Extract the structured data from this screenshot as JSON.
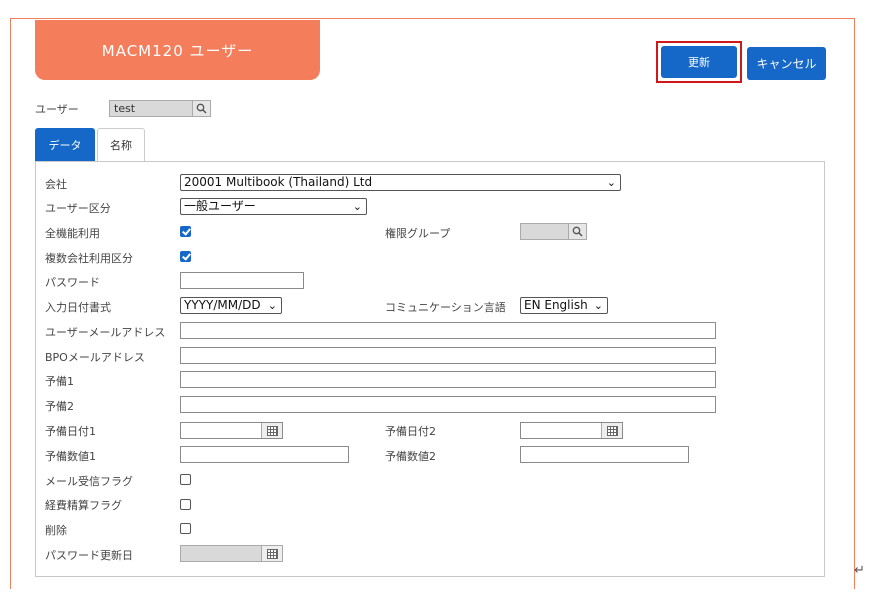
{
  "header": {
    "title": "MACM120 ユーザー",
    "update_label": "更新",
    "cancel_label": "キャンセル"
  },
  "user": {
    "label": "ユーザー",
    "value": "test"
  },
  "tabs": [
    {
      "label": "データ",
      "active": true
    },
    {
      "label": "名称",
      "active": false
    }
  ],
  "form": {
    "company": {
      "label": "会社",
      "value": "20001 Multibook (Thailand) Ltd"
    },
    "user_type": {
      "label": "ユーザー区分",
      "value": "一般ユーザー"
    },
    "all_functions": {
      "label": "全機能利用",
      "checked": true
    },
    "permission_group": {
      "label": "権限グループ",
      "value": ""
    },
    "multi_company": {
      "label": "複数会社利用区分",
      "checked": true
    },
    "password": {
      "label": "パスワード",
      "value": ""
    },
    "date_format": {
      "label": "入力日付書式",
      "value": "YYYY/MM/DD"
    },
    "comm_language": {
      "label": "コミュニケーション言語",
      "value": "EN English"
    },
    "user_email": {
      "label": "ユーザーメールアドレス",
      "value": ""
    },
    "bpo_email": {
      "label": "BPOメールアドレス",
      "value": ""
    },
    "spare1": {
      "label": "予備1",
      "value": ""
    },
    "spare2": {
      "label": "予備2",
      "value": ""
    },
    "spare_date1": {
      "label": "予備日付1",
      "value": ""
    },
    "spare_date2": {
      "label": "予備日付2",
      "value": ""
    },
    "spare_num1": {
      "label": "予備数値1",
      "value": ""
    },
    "spare_num2": {
      "label": "予備数値2",
      "value": ""
    },
    "mail_flag": {
      "label": "メール受信フラグ",
      "checked": false
    },
    "expense_flag": {
      "label": "経費精算フラグ",
      "checked": false
    },
    "delete": {
      "label": "削除",
      "checked": false
    },
    "password_updated": {
      "label": "パスワード更新日",
      "value": ""
    }
  },
  "colors": {
    "accent_blue": "#1567c8",
    "title_orange": "#f47e5b",
    "highlight_red": "#d01818"
  }
}
